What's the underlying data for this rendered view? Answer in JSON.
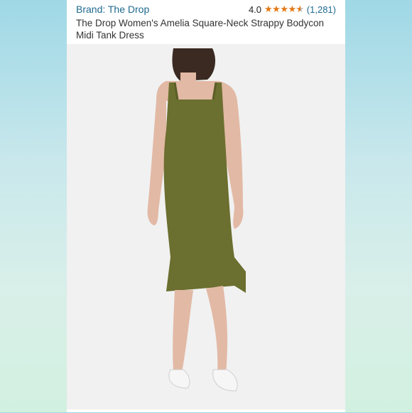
{
  "brand": {
    "label": "Brand: The Drop"
  },
  "rating": {
    "value": "4.0",
    "stars": 4.0,
    "reviews": "(1,281)"
  },
  "product": {
    "title": "The Drop Women's Amelia Square-Neck Strappy Bodycon Midi Tank Dress"
  },
  "colors": {
    "accent": "#1f6a8f",
    "star": "#e47911",
    "dress": "#6b6f2f"
  }
}
